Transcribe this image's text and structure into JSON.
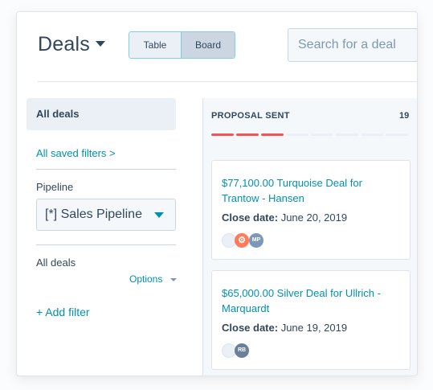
{
  "header": {
    "title": "Deals",
    "view_toggle": {
      "table_label": "Table",
      "board_label": "Board",
      "selected": "Board"
    },
    "search": {
      "placeholder": "Search for a deal"
    }
  },
  "sidebar": {
    "selected_view": "All deals",
    "saved_filters_link": "All saved filters >",
    "pipeline_label": "Pipeline",
    "pipeline_value": "[*] Sales Pipeline",
    "view_heading": "All deals",
    "options_label": "Options",
    "add_filter_label": "+  Add filter"
  },
  "board": {
    "column": {
      "name": "PROPOSAL SENT",
      "count": "19",
      "progress": {
        "filled": 3,
        "total": 8,
        "filled_color": "#f2545b",
        "empty_color": "#eaf0f6"
      }
    },
    "cards": [
      {
        "title": "$77,100.00 Turquoise Deal for Trantow - Hansen",
        "close_label": "Close date:",
        "close_value": " June 20, 2019",
        "avatars": [
          "MP"
        ]
      },
      {
        "title": "$65,000.00 Silver Deal for Ullrich - Marquardt",
        "close_label": "Close date:",
        "close_value": " June 19, 2019",
        "avatars": [
          "RB"
        ]
      }
    ]
  },
  "colors": {
    "accent": "#0091ae",
    "text": "#33475b",
    "hubspot_orange": "#ff7a59"
  }
}
